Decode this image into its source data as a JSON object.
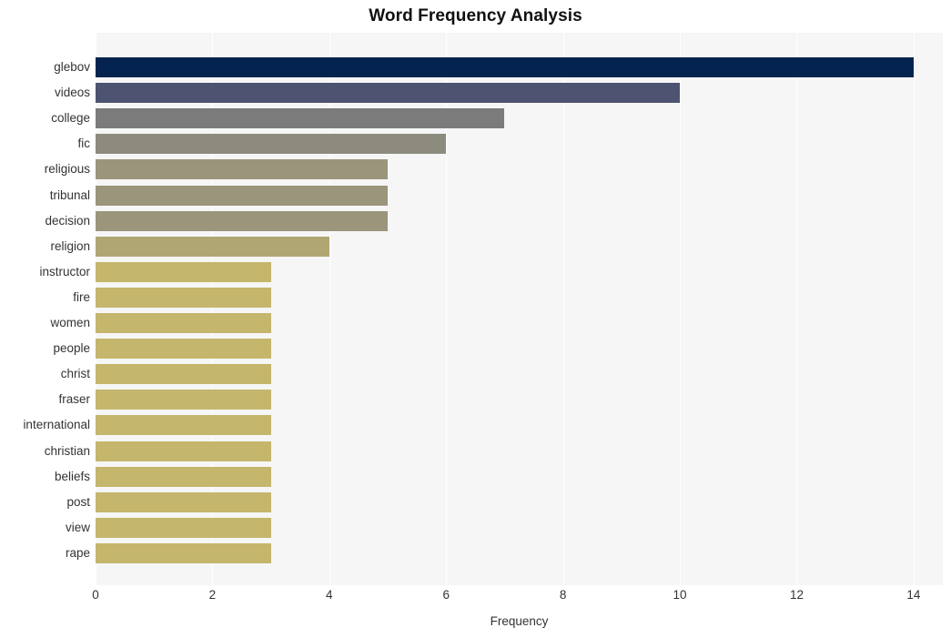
{
  "chart_data": {
    "type": "bar",
    "orientation": "horizontal",
    "title": "Word Frequency Analysis",
    "xlabel": "Frequency",
    "ylabel": "",
    "xlim": [
      0,
      14.5
    ],
    "xticks": [
      0,
      2,
      4,
      6,
      8,
      10,
      12,
      14
    ],
    "xtick_labels": [
      "0",
      "2",
      "4",
      "6",
      "8",
      "10",
      "12",
      "14"
    ],
    "grid": "vertical-white-gridlines",
    "legend": "none",
    "categories": [
      "glebov",
      "videos",
      "college",
      "fic",
      "religious",
      "tribunal",
      "decision",
      "religion",
      "instructor",
      "fire",
      "women",
      "people",
      "christ",
      "fraser",
      "international",
      "christian",
      "beliefs",
      "post",
      "view",
      "rape"
    ],
    "values": [
      14,
      10,
      7,
      6,
      5,
      5,
      5,
      4,
      3,
      3,
      3,
      3,
      3,
      3,
      3,
      3,
      3,
      3,
      3,
      3
    ],
    "bar_colors": [
      "#04244f",
      "#4d5370",
      "#7b7b7b",
      "#8d8b7e",
      "#9b957c",
      "#9b957c",
      "#9b957c",
      "#b0a673",
      "#c4b66c",
      "#c4b66c",
      "#c4b66c",
      "#c4b66c",
      "#c4b66c",
      "#c4b66c",
      "#c4b66c",
      "#c4b66c",
      "#c4b66c",
      "#c4b66c",
      "#c4b66c",
      "#c4b66c"
    ],
    "plot_background": "#f6f6f6",
    "figure_background": "#ffffff",
    "text_color": "#333333",
    "title_color": "#111111"
  }
}
